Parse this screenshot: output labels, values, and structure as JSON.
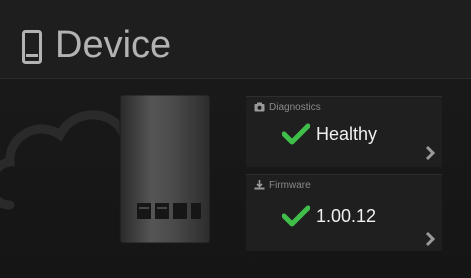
{
  "header": {
    "title": "Device",
    "icon": "device-icon"
  },
  "diagnostics": {
    "label": "Diagnostics",
    "value": "Healthy",
    "status_icon": "checkmark-icon",
    "status_color": "#3fbf4a"
  },
  "firmware": {
    "label": "Firmware",
    "value": "1.00.12",
    "status_icon": "checkmark-icon",
    "status_color": "#3fbf4a"
  },
  "colors": {
    "background": "#151515",
    "title": "#b3b3b3",
    "check": "#3fbf4a",
    "chevron": "#9a9a9a"
  }
}
